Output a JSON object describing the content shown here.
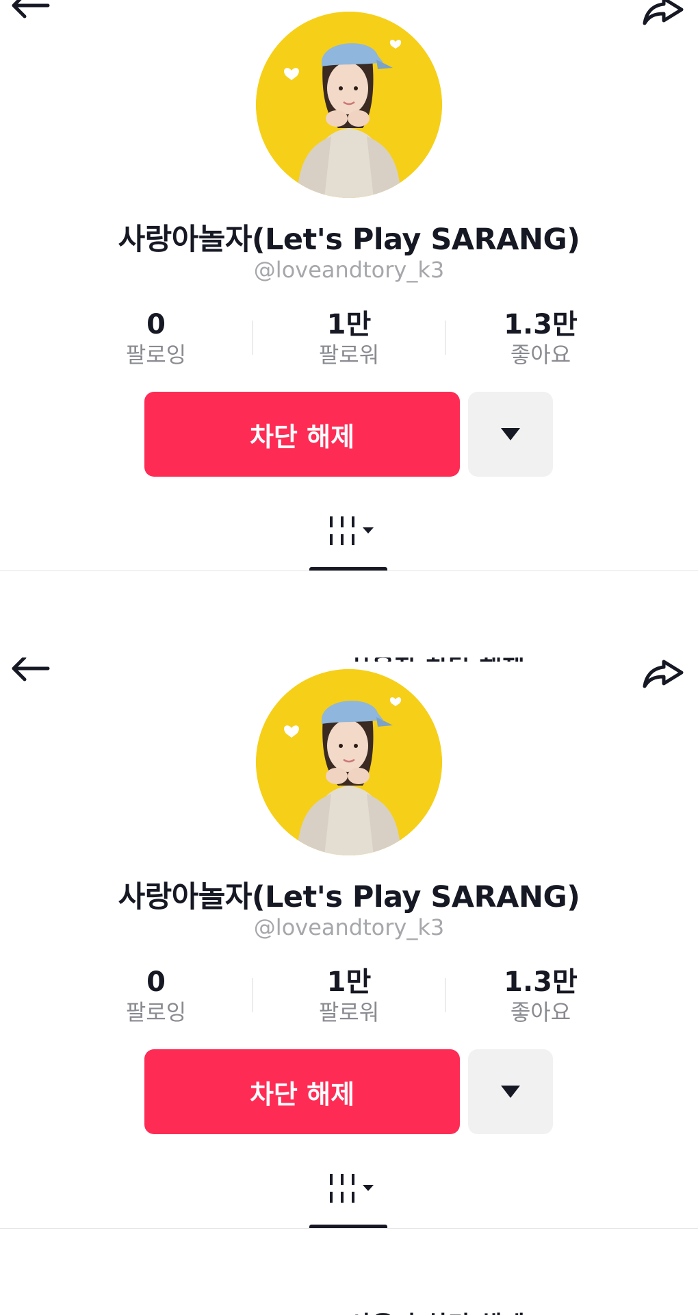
{
  "profile": {
    "display_name": "사랑아놀자(Let's Play SARANG)",
    "username": "@loveandtory_k3",
    "stats": [
      {
        "value": "0",
        "label": "팔로잉"
      },
      {
        "value": "1만",
        "label": "팔로워"
      },
      {
        "value": "1.3만",
        "label": "좋아요"
      }
    ]
  },
  "actions": {
    "unblock_label": "차단 해제",
    "more_icon": "caret-down-icon"
  },
  "header": {
    "back_icon": "back-arrow-icon",
    "share_icon": "share-icon"
  },
  "tabs": {
    "filter_icon": "grid-filter-icon"
  },
  "overlap_text": "사용자 차단 해제",
  "colors": {
    "accent": "#fe2c55",
    "avatar_bg": "#f6cf18",
    "secondary_text": "#a6a7ab",
    "button_gray": "#f1f1f2"
  }
}
